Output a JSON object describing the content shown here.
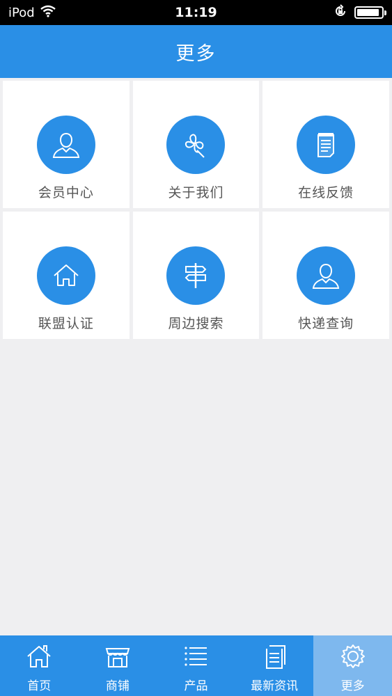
{
  "status_bar": {
    "device": "iPod",
    "time": "11:19",
    "battery_level": 0.9,
    "icons": [
      "wifi-icon",
      "orientation-lock-icon",
      "battery-icon"
    ]
  },
  "header": {
    "title": "更多"
  },
  "tiles": [
    {
      "label": "会员中心",
      "icon": "user-icon"
    },
    {
      "label": "关于我们",
      "icon": "clover-icon"
    },
    {
      "label": "在线反馈",
      "icon": "notepad-icon"
    },
    {
      "label": "联盟认证",
      "icon": "home-icon"
    },
    {
      "label": "周边搜索",
      "icon": "signpost-icon"
    },
    {
      "label": "快递查询",
      "icon": "user-icon"
    }
  ],
  "tabbar": {
    "items": [
      {
        "label": "首页",
        "icon": "home-icon"
      },
      {
        "label": "商铺",
        "icon": "store-icon"
      },
      {
        "label": "产品",
        "icon": "list-icon"
      },
      {
        "label": "最新资讯",
        "icon": "document-icon"
      },
      {
        "label": "更多",
        "icon": "gear-icon"
      }
    ],
    "active": "更多"
  },
  "colors": {
    "primary": "#2a8fe6",
    "active_tab": "#7eb8ee",
    "background": "#efeff1",
    "tile_background": "#ffffff"
  }
}
